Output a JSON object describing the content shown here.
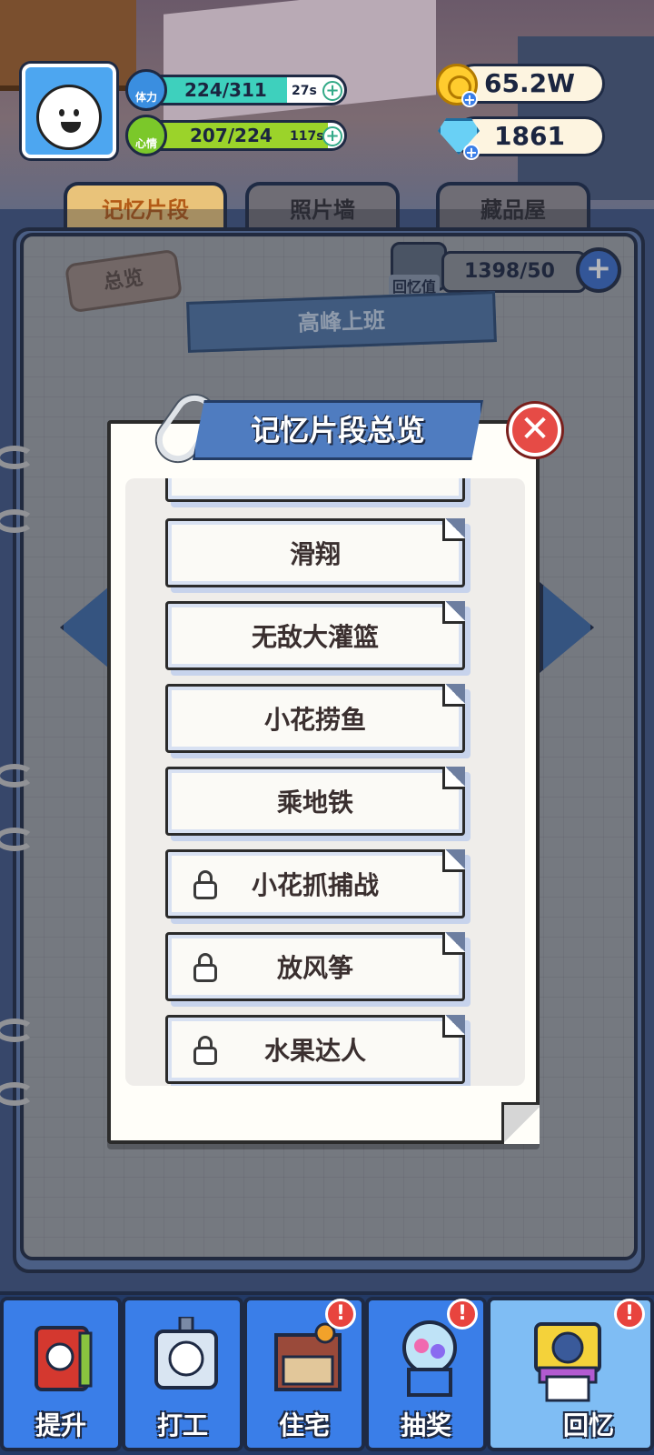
{
  "header": {
    "stamina": {
      "label": "体力",
      "value": "224/311",
      "timer": "27s",
      "fraction": 0.72
    },
    "mood": {
      "label": "心情",
      "value": "207/224",
      "timer": "117s",
      "fraction": 0.92
    },
    "coins": "65.2W",
    "gems": "1861"
  },
  "tabs": [
    {
      "label": "记忆片段",
      "active": true
    },
    {
      "label": "照片墙",
      "active": false
    },
    {
      "label": "藏品屋",
      "active": false
    }
  ],
  "page": {
    "overview_tag": "总览",
    "memory_label": "回忆值",
    "memory_value": "1398/50",
    "chapter_title": "高峰上班"
  },
  "modal": {
    "title": "记忆片段总览",
    "close_label": "✕",
    "items": [
      {
        "label": "滑翔",
        "locked": false
      },
      {
        "label": "无敌大灌篮",
        "locked": false
      },
      {
        "label": "小花捞鱼",
        "locked": false
      },
      {
        "label": "乘地铁",
        "locked": false
      },
      {
        "label": "小花抓捕战",
        "locked": true
      },
      {
        "label": "放风筝",
        "locked": true
      },
      {
        "label": "水果达人",
        "locked": true
      }
    ]
  },
  "bottom_nav": [
    {
      "label": "提升",
      "badge": "",
      "active": false,
      "icon": "book-icon"
    },
    {
      "label": "打工",
      "badge": "",
      "active": false,
      "icon": "id-card-icon"
    },
    {
      "label": "住宅",
      "badge": "!",
      "active": false,
      "icon": "house-icon"
    },
    {
      "label": "抽奖",
      "badge": "!",
      "active": false,
      "icon": "gacha-machine-icon"
    },
    {
      "label": "回忆",
      "badge": "!",
      "active": true,
      "icon": "camera-icon"
    }
  ],
  "colors": {
    "stamina_fill": "#3ed0bd",
    "mood_fill": "#9bd32a",
    "accent_blue": "#3a7ee8",
    "close_red": "#e64b46"
  }
}
